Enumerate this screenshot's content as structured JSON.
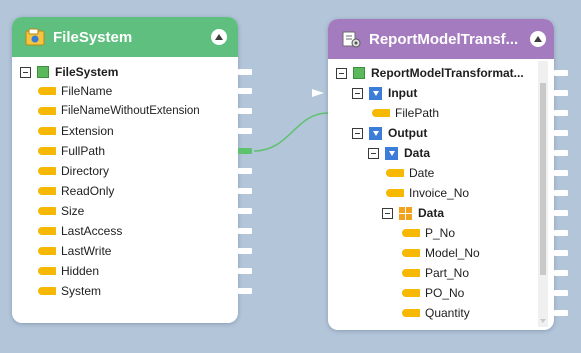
{
  "source_node": {
    "title": "FileSystem",
    "header_color": "#5fbf7f",
    "root": {
      "label": "FileSystem",
      "icon": "table-icon"
    },
    "fields": [
      "FileName",
      "FileNameWithoutExtension",
      "Extension",
      "FullPath",
      "Directory",
      "ReadOnly",
      "Size",
      "LastAccess",
      "LastWrite",
      "Hidden",
      "System"
    ]
  },
  "target_node": {
    "title": "ReportModelTransf...",
    "header_color": "#a57bbf",
    "root": {
      "label": "ReportModelTransformat...",
      "icon": "table-icon"
    },
    "input": {
      "label": "Input",
      "fields": [
        "FilePath"
      ]
    },
    "output": {
      "label": "Output",
      "data": {
        "label": "Data",
        "fields": [
          "Date",
          "Invoice_No"
        ],
        "nested": {
          "label": "Data",
          "fields": [
            "P_No",
            "Model_No",
            "Part_No",
            "PO_No",
            "Quantity"
          ]
        }
      }
    }
  },
  "connection": {
    "from": "FullPath",
    "to": "FilePath",
    "color": "#5cc26e"
  }
}
